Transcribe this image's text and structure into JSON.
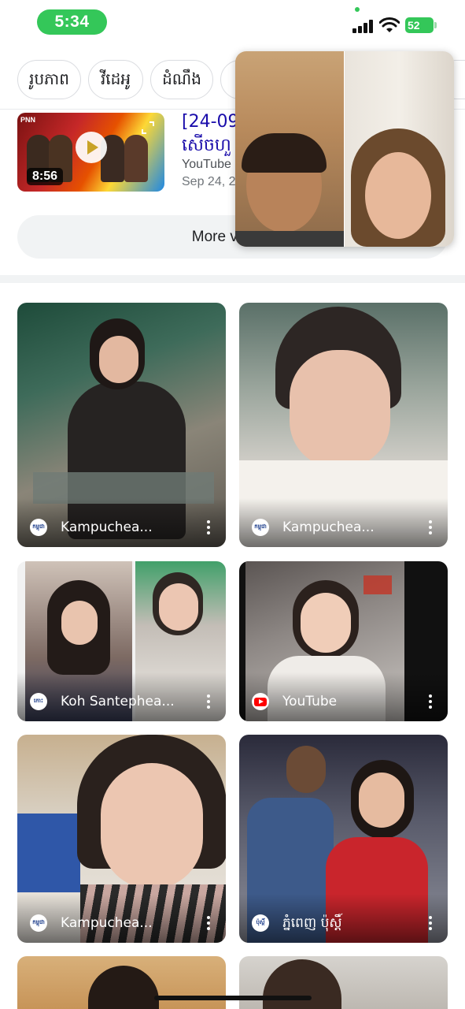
{
  "status_bar": {
    "time": "5:34",
    "battery": "52"
  },
  "chips": [
    {
      "label": "រូបភាព"
    },
    {
      "label": "វីដេអូ"
    },
    {
      "label": "ដំណឹង"
    }
  ],
  "video_result": {
    "title": "[24-09",
    "title_line2": "សើចហួ",
    "source": "YouTube",
    "date": "Sep 24, 2",
    "duration": "8:56",
    "thumb_channel": "PNN"
  },
  "more_videos_label": "More videos",
  "images": [
    {
      "source": "Kampuchea...",
      "favicon_text": "កម្ពុជា"
    },
    {
      "source": "Kampuchea...",
      "favicon_text": "កម្ពុជា"
    },
    {
      "source": "Koh Santephea...",
      "favicon_text": "កោះ"
    },
    {
      "source": "YouTube",
      "favicon": "youtube-icon"
    },
    {
      "source": "Kampuchea...",
      "favicon_text": "កម្ពុជា"
    },
    {
      "source": "ភ្នំពេញ ប៉ុស្តិ៍",
      "favicon_text": "ប៉ុស្តិ៍"
    }
  ],
  "colors": {
    "accent_green": "#34c759",
    "link_blue": "#1a0dab",
    "chip_border": "#dadce0"
  }
}
